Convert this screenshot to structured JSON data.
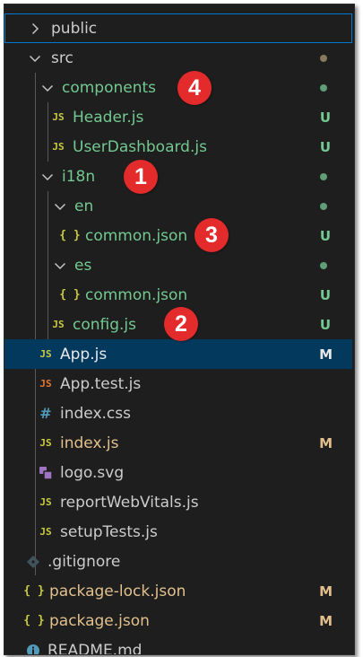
{
  "explorer": {
    "rows": [
      {
        "label": "public"
      },
      {
        "label": "src"
      },
      {
        "label": "components"
      },
      {
        "label": "Header.js",
        "icon": "JS",
        "status": "U"
      },
      {
        "label": "UserDashboard.js",
        "icon": "JS",
        "status": "U"
      },
      {
        "label": "i18n"
      },
      {
        "label": "en"
      },
      {
        "label": "common.json",
        "icon": "{ }",
        "status": "U"
      },
      {
        "label": "es"
      },
      {
        "label": "common.json",
        "icon": "{ }",
        "status": "U"
      },
      {
        "label": "config.js",
        "icon": "JS",
        "status": "U"
      },
      {
        "label": "App.js",
        "icon": "JS",
        "status": "M"
      },
      {
        "label": "App.test.js",
        "icon": "JS"
      },
      {
        "label": "index.css",
        "icon": "#"
      },
      {
        "label": "index.js",
        "icon": "JS",
        "status": "M"
      },
      {
        "label": "logo.svg"
      },
      {
        "label": "reportWebVitals.js",
        "icon": "JS"
      },
      {
        "label": "setupTests.js",
        "icon": "JS"
      },
      {
        "label": ".gitignore"
      },
      {
        "label": "package-lock.json",
        "icon": "{ }",
        "status": "M"
      },
      {
        "label": "package.json",
        "icon": "{ }",
        "status": "M"
      },
      {
        "label": "README.md"
      }
    ]
  },
  "callouts": [
    "4",
    "1",
    "3",
    "2"
  ],
  "colors": {
    "background": "#1e1e1e",
    "selected": "#04395e",
    "untracked": "#73c991",
    "modified": "#e2c08d",
    "js_icon": "#cbcb41",
    "callout": "#e32b2b"
  }
}
